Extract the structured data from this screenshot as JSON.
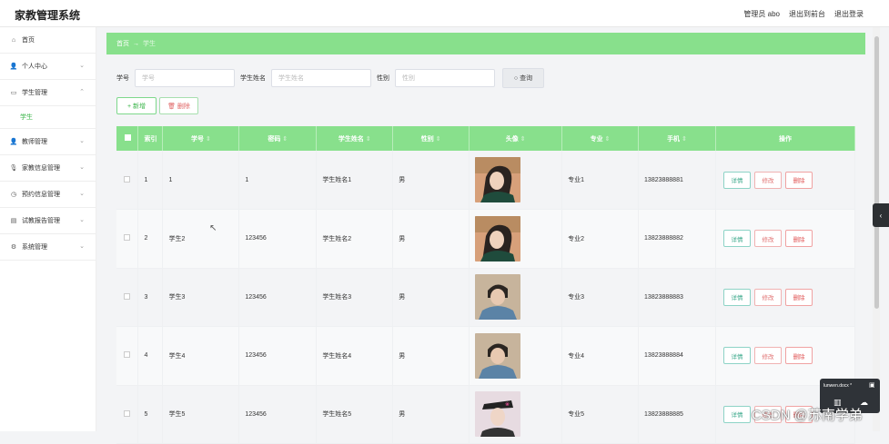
{
  "app": {
    "title": "家教管理系统"
  },
  "header": {
    "user": "管理员 abo",
    "back_front": "退出到前台",
    "logout": "退出登录"
  },
  "sidebar": {
    "items": [
      {
        "label": "首页",
        "icon": "home-icon",
        "glyph": "⌂",
        "has_chevron": false
      },
      {
        "label": "个人中心",
        "icon": "user-icon",
        "glyph": "👤",
        "has_chevron": true
      },
      {
        "label": "学生管理",
        "icon": "monitor-icon",
        "glyph": "▭",
        "has_chevron": true,
        "expanded": true,
        "sub": "学生"
      },
      {
        "label": "教师管理",
        "icon": "teacher-icon",
        "glyph": "👤",
        "has_chevron": true
      },
      {
        "label": "家教信息管理",
        "icon": "mic-icon",
        "glyph": "🎙",
        "has_chevron": true
      },
      {
        "label": "预约信息管理",
        "icon": "clock-icon",
        "glyph": "◷",
        "has_chevron": true
      },
      {
        "label": "试教报告管理",
        "icon": "clipboard-icon",
        "glyph": "▤",
        "has_chevron": true
      },
      {
        "label": "系统管理",
        "icon": "gear-icon",
        "glyph": "⚙",
        "has_chevron": true
      }
    ]
  },
  "breadcrumb": {
    "home": "首页",
    "sep": "→",
    "current": "学生"
  },
  "search": {
    "no_label": "学号",
    "no_placeholder": "学号",
    "name_label": "学生姓名",
    "name_placeholder": "学生姓名",
    "gender_label": "性别",
    "gender_placeholder": "性别",
    "query_button": "查询"
  },
  "actions": {
    "add": "+ 新增",
    "delete": "🗑 删除"
  },
  "table": {
    "headers": [
      "索引",
      "学号",
      "密码",
      "学生姓名",
      "性别",
      "头像",
      "专业",
      "手机",
      "操作"
    ],
    "row_buttons": {
      "detail": "详情",
      "edit": "修改",
      "remove": "删除"
    },
    "rows": [
      {
        "index": "1",
        "no": "1",
        "password": "1",
        "name": "学生姓名1",
        "gender": "男",
        "major": "专业1",
        "phone": "13823888881"
      },
      {
        "index": "2",
        "no": "学生2",
        "password": "123456",
        "name": "学生姓名2",
        "gender": "男",
        "major": "专业2",
        "phone": "13823888882"
      },
      {
        "index": "3",
        "no": "学生3",
        "password": "123456",
        "name": "学生姓名3",
        "gender": "男",
        "major": "专业3",
        "phone": "13823888883"
      },
      {
        "index": "4",
        "no": "学生4",
        "password": "123456",
        "name": "学生姓名4",
        "gender": "男",
        "major": "专业4",
        "phone": "13823888884"
      },
      {
        "index": "5",
        "no": "学生5",
        "password": "123456",
        "name": "学生姓名5",
        "gender": "男",
        "major": "专业5",
        "phone": "13823888885"
      }
    ]
  },
  "overlay": {
    "popup_title": "lunwen.docx *",
    "watermark": "CSDN @苏南学弟"
  },
  "colors": {
    "accent": "#88e08c",
    "link": "#3bb54a",
    "danger": "#e05555"
  }
}
